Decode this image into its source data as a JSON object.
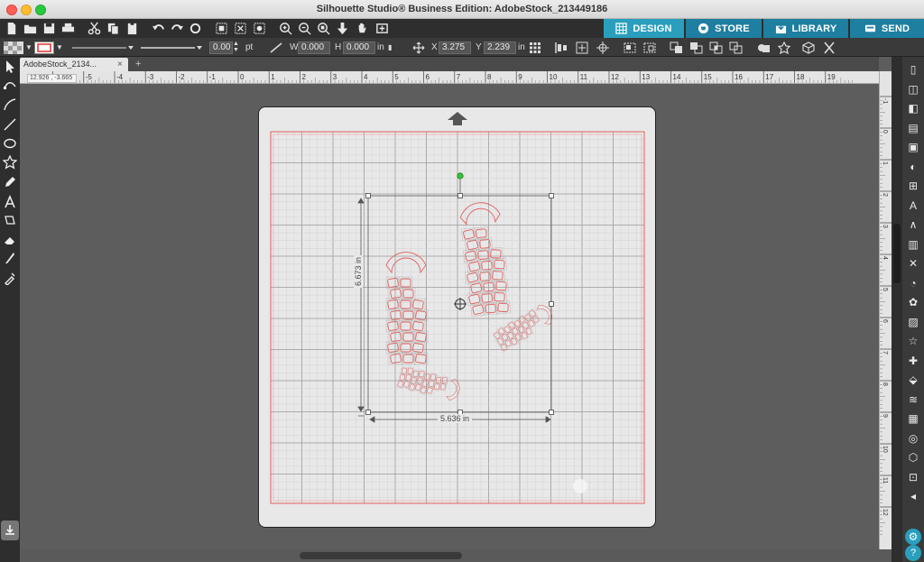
{
  "window": {
    "title": "Silhouette Studio® Business Edition: AdobeStock_213449186"
  },
  "nav": {
    "design": "DESIGN",
    "store": "STORE",
    "library": "LIBRARY",
    "send": "SEND"
  },
  "properties": {
    "stroke_width": "0.00",
    "stroke_unit": "pt",
    "w_label": "W",
    "w_value": "0.000",
    "h_label": "H",
    "h_value": "0.000",
    "h_unit": "in",
    "x_label": "X",
    "x_value": "3.275",
    "y_label": "Y",
    "y_value": "2.239",
    "y_unit": "in"
  },
  "document": {
    "tab_label": "AdobeStock_2134...",
    "tab_close": "×",
    "tab_add": "+",
    "cursor_coords": "12.926 , -3.665"
  },
  "ruler": {
    "top_labels": [
      "-6",
      "-5",
      "-4",
      "-3",
      "-2",
      "-1",
      "0",
      "1",
      "2",
      "3",
      "4",
      "5",
      "6",
      "7",
      "8",
      "9",
      "10",
      "11",
      "12",
      "13",
      "14",
      "15",
      "16",
      "17",
      "18",
      "19"
    ],
    "right_labels": [
      "-1",
      "0",
      "1",
      "2",
      "3",
      "4",
      "5",
      "6",
      "7",
      "8",
      "9",
      "10",
      "11",
      "12"
    ]
  },
  "selection": {
    "height_label": "6.673 in",
    "width_label": "5.636 in"
  },
  "colors": {
    "accent": "#2a9fbd",
    "nav_inactive": "#1e7fa0",
    "cut_line": "#e06060",
    "rotate_handle": "#39c239"
  }
}
